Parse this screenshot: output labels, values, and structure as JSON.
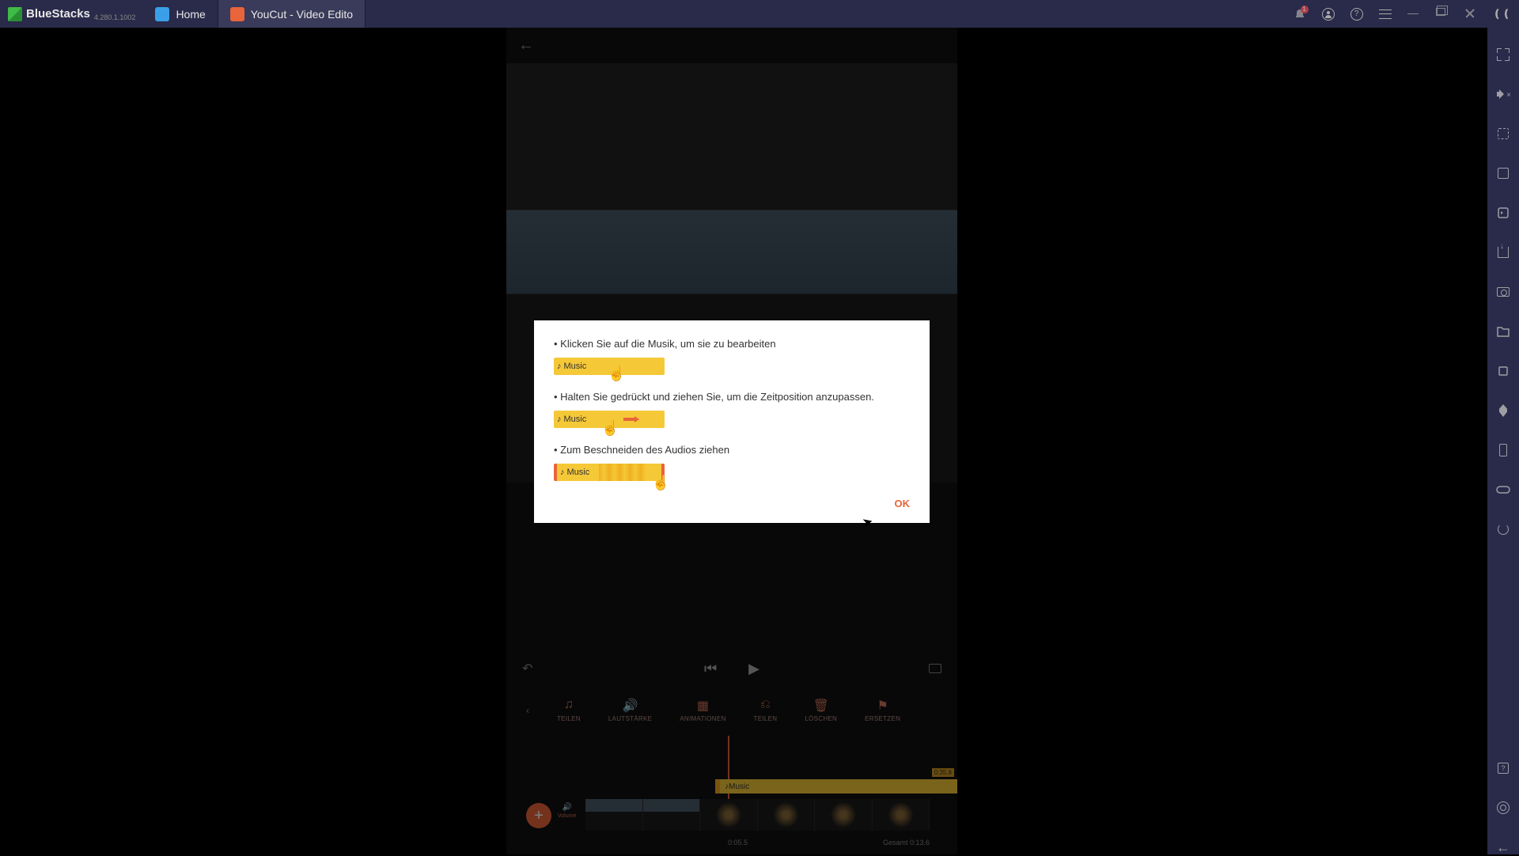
{
  "titlebar": {
    "brand": "BlueStacks",
    "version": "4.280.1.1002",
    "tabs": [
      {
        "label": "Home"
      },
      {
        "label": "YouCut - Video Edito"
      }
    ],
    "notification_count": "1"
  },
  "dialog": {
    "items": [
      {
        "text": "• Klicken Sie auf die Musik, um sie zu bearbeiten",
        "clip_label": "Music"
      },
      {
        "text": "• Halten Sie gedrückt und ziehen Sie, um die Zeitposition anzupassen.",
        "clip_label": "Music"
      },
      {
        "text": "• Zum Beschneiden des Audios ziehen",
        "clip_label": "Music"
      }
    ],
    "ok": "OK"
  },
  "tools": [
    {
      "label": "Teilen"
    },
    {
      "label": "Lautstärke"
    },
    {
      "label": "Animationen"
    },
    {
      "label": "Teilen"
    },
    {
      "label": "Löschen"
    },
    {
      "label": "Ersetzen"
    }
  ],
  "timeline": {
    "music_label": "Music",
    "music_duration": "0:35.8",
    "current_time": "0:05.5",
    "total_label": "Gesamt 0:13.6",
    "volume_label": "Volume"
  }
}
